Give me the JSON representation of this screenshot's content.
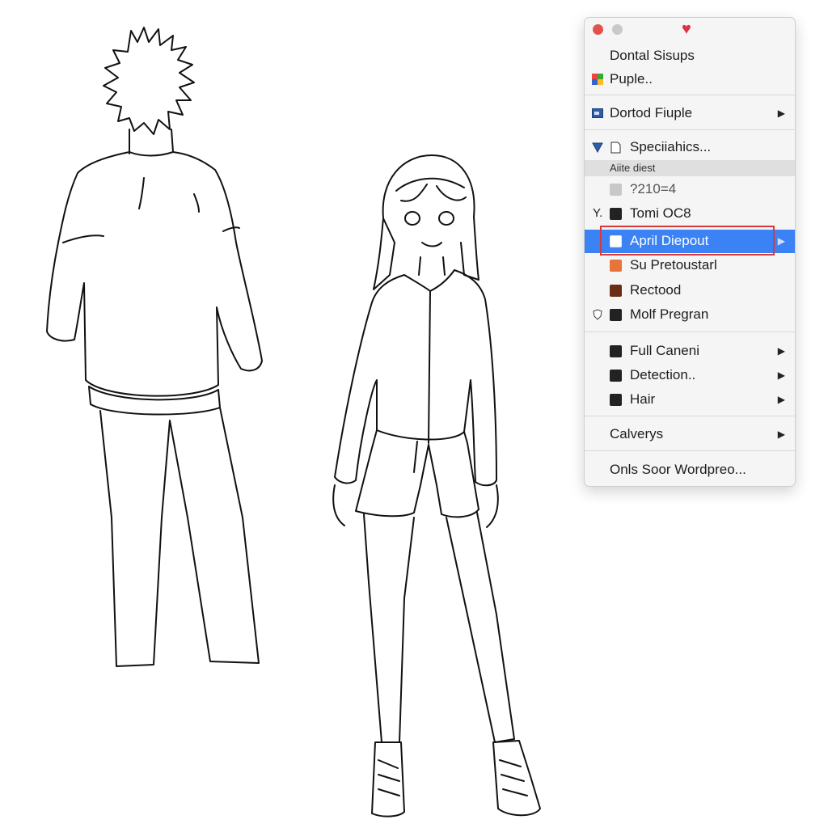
{
  "menu": {
    "heart_icon": "heart-icon",
    "items": [
      {
        "label": "Dontal Sisups"
      },
      {
        "label": "Puple.."
      },
      {
        "label": "Dortod Fiuple",
        "submenu": true
      },
      {
        "label": "Speciiahics..."
      },
      {
        "label": "Aiite diest"
      },
      {
        "label": "?210=4"
      },
      {
        "label": "Tomi OC8",
        "prefix": "Y."
      },
      {
        "label": "April Diepout",
        "selected": true
      },
      {
        "label": "Su Pretoustarl"
      },
      {
        "label": "Rectood"
      },
      {
        "label": "Molf Pregran"
      },
      {
        "label": "Full Caneni",
        "submenu": true
      },
      {
        "label": "Detection..",
        "submenu": true
      },
      {
        "label": "Hair",
        "submenu": true
      },
      {
        "label": "Calverys",
        "submenu": true
      },
      {
        "label": "Onls Soor Wordpreo..."
      }
    ],
    "colors": {
      "selection": "#3b82f5",
      "outline": "#d83a3a",
      "close": "#e3514d"
    }
  }
}
